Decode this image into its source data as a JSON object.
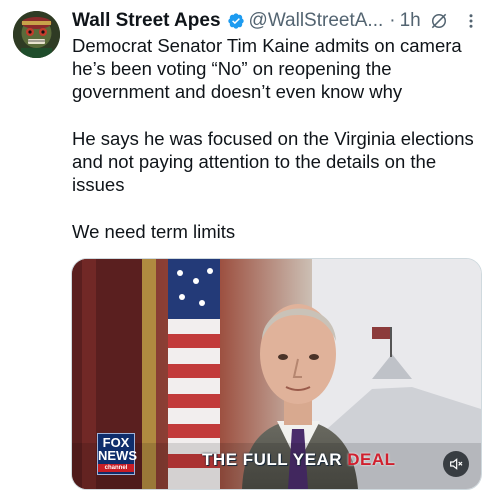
{
  "tweet": {
    "author_name": "Wall Street Apes",
    "handle": "@WallStreetA...",
    "separator": "·",
    "time": "1h",
    "paragraphs": [
      "Democrat Senator Tim Kaine admits on camera he’s been voting “No” on reopening the government and doesn’t even know why",
      "He says he was focused on the Virginia elections and not paying attention to the details on the issues",
      "We need term limits"
    ]
  },
  "video": {
    "chyron_prefix": "THE FULL YEAR ",
    "chyron_highlight": "DEAL",
    "network_logo": "FOX",
    "network_logo_line2": "NEWS",
    "network_logo_line3": "channel",
    "mute_icon": "speaker-muted-icon"
  },
  "colors": {
    "verified": "#1d9bf0",
    "secondary_text": "#536471",
    "chyron_highlight": "#d0202e"
  }
}
